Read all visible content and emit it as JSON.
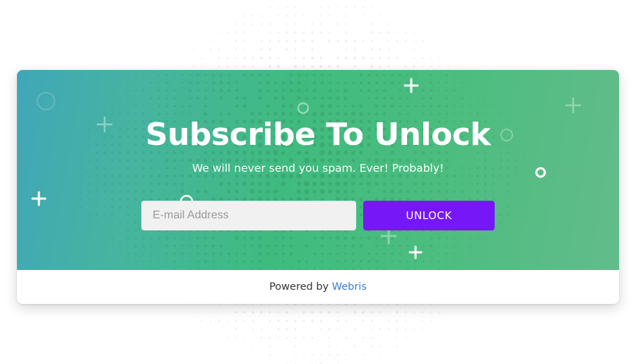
{
  "hero": {
    "title": "Subscribe To Unlock",
    "subtitle": "We will never send you spam. Ever! Probably!"
  },
  "form": {
    "email_placeholder": "E-mail Address",
    "email_value": "",
    "button_label": "UNLOCK"
  },
  "footer": {
    "powered_by": "Powered by",
    "brand": "Webris"
  },
  "colors": {
    "gradient_start": "#40a6b8",
    "gradient_mid": "#40bb7f",
    "gradient_end": "#63bc8b",
    "button": "#7617f7",
    "link": "#3b7bd4",
    "input_bg": "#f1f1f1"
  },
  "icons": [
    "plus-icon",
    "ring-icon"
  ]
}
